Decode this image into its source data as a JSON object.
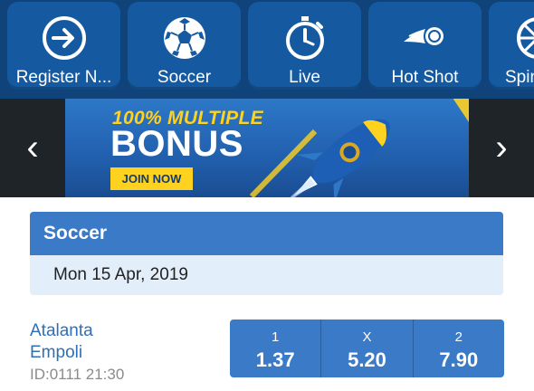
{
  "nav": {
    "tiles": [
      {
        "label": "Register N...",
        "icon": "arrow-right-circle-icon"
      },
      {
        "label": "Soccer",
        "icon": "soccer-ball-icon"
      },
      {
        "label": "Live",
        "icon": "stopwatch-icon"
      },
      {
        "label": "Hot Shot",
        "icon": "fireball-icon"
      },
      {
        "label": "Spin",
        "icon": "spin-wheel-icon"
      }
    ]
  },
  "banner": {
    "line1": "100% MULTIPLE",
    "line2": "BONUS",
    "cta": "JOIN NOW",
    "prev_glyph": "‹",
    "next_glyph": "›"
  },
  "section": {
    "title": "Soccer",
    "date": "Mon 15 Apr, 2019"
  },
  "match": {
    "home": "Atalanta",
    "away": "Empoli",
    "meta": "ID:0111 21:30",
    "odds": [
      {
        "key": "1",
        "value": "1.37"
      },
      {
        "key": "X",
        "value": "5.20"
      },
      {
        "key": "2",
        "value": "7.90"
      }
    ]
  },
  "colors": {
    "nav_bg": "#10437a",
    "tile_bg": "#155aa0",
    "accent": "#3a7ac6",
    "date_bg": "#e3eefb",
    "link": "#2f6fb8",
    "bonus_yellow": "#ffd21f"
  }
}
